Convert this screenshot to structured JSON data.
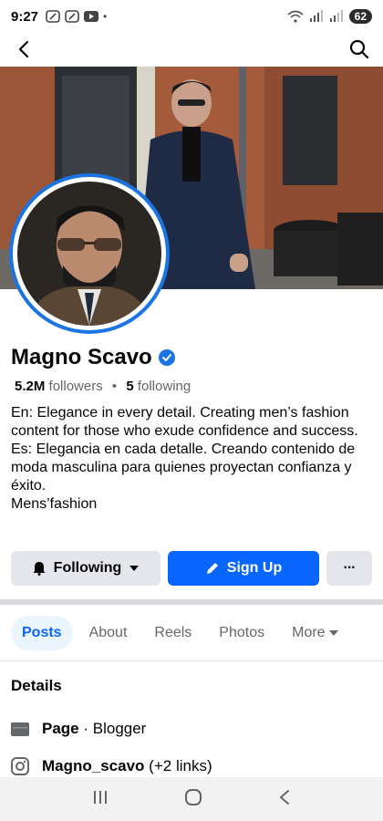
{
  "status_bar": {
    "time": "9:27",
    "battery": "62",
    "dot": "•"
  },
  "app_bar": {
    "back_icon": "back-arrow-icon",
    "search_icon": "search-icon"
  },
  "profile": {
    "name": "Magno Scavo",
    "verified": true,
    "followers_count": "5.2M",
    "followers_label": "followers",
    "separator": "•",
    "following_count": "5",
    "following_label": "following",
    "bio_lines": [
      "En: Elegance in every detail. Creating men’s fashion content for those who exude confidence and success.",
      "Es: Elegancia en cada detalle. Creando contenido de moda masculina para quienes proyectan confianza y éxito.",
      "Mens’fashion"
    ]
  },
  "actions": {
    "following_label": "Following",
    "signup_label": "Sign Up",
    "more_label": "···"
  },
  "tabs": [
    {
      "label": "Posts",
      "active": true
    },
    {
      "label": "About",
      "active": false
    },
    {
      "label": "Reels",
      "active": false
    },
    {
      "label": "Photos",
      "active": false
    },
    {
      "label": "More",
      "active": false
    }
  ],
  "details": {
    "title": "Details",
    "page_label": "Page",
    "page_separator": " · ",
    "page_category": "Blogger",
    "instagram_handle": "Magno_scavo",
    "instagram_extra": "(+2 links)"
  },
  "colors": {
    "accent": "#0866ff",
    "verified": "#1b74e4",
    "secondary_text": "#65676b",
    "button_gray": "#e4e6eb"
  }
}
